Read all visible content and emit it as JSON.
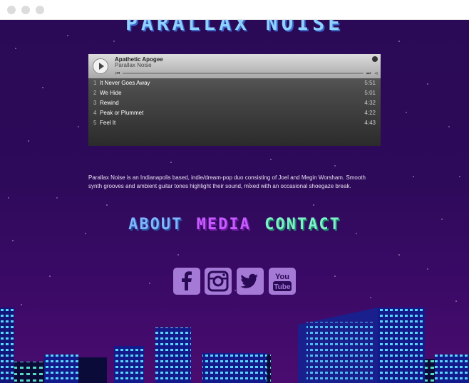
{
  "site": {
    "title": "PARALLAX NOISE"
  },
  "player": {
    "album": "Apathetic Apogee",
    "artist": "Parallax Noise",
    "tracks": [
      {
        "num": "1",
        "name": "It Never Goes Away",
        "duration": "5:51"
      },
      {
        "num": "2",
        "name": "We Hide",
        "duration": "5:01"
      },
      {
        "num": "3",
        "name": "Rewind",
        "duration": "4:32"
      },
      {
        "num": "4",
        "name": "Peak or Plummet",
        "duration": "4:22"
      },
      {
        "num": "5",
        "name": "Feel It",
        "duration": "4:43"
      }
    ]
  },
  "bio": "Parallax Noise is an Indianapolis based, indie/dream-pop duo consisting of Joel and Megin Worsham. Smooth synth grooves and ambient guitar tones highlight their sound, mixed with an occasional shoegaze break.",
  "nav": {
    "about": "ABOUT",
    "media": "MEDIA",
    "contact": "CONTACT"
  },
  "social": [
    "facebook-icon",
    "instagram-icon",
    "twitter-icon",
    "youtube-icon"
  ],
  "colors": {
    "background": "#2a0a52",
    "nav_about": "#7fb6ff",
    "nav_media": "#c85bff",
    "nav_contact": "#7ff0c8",
    "social": "#a57ad6"
  }
}
